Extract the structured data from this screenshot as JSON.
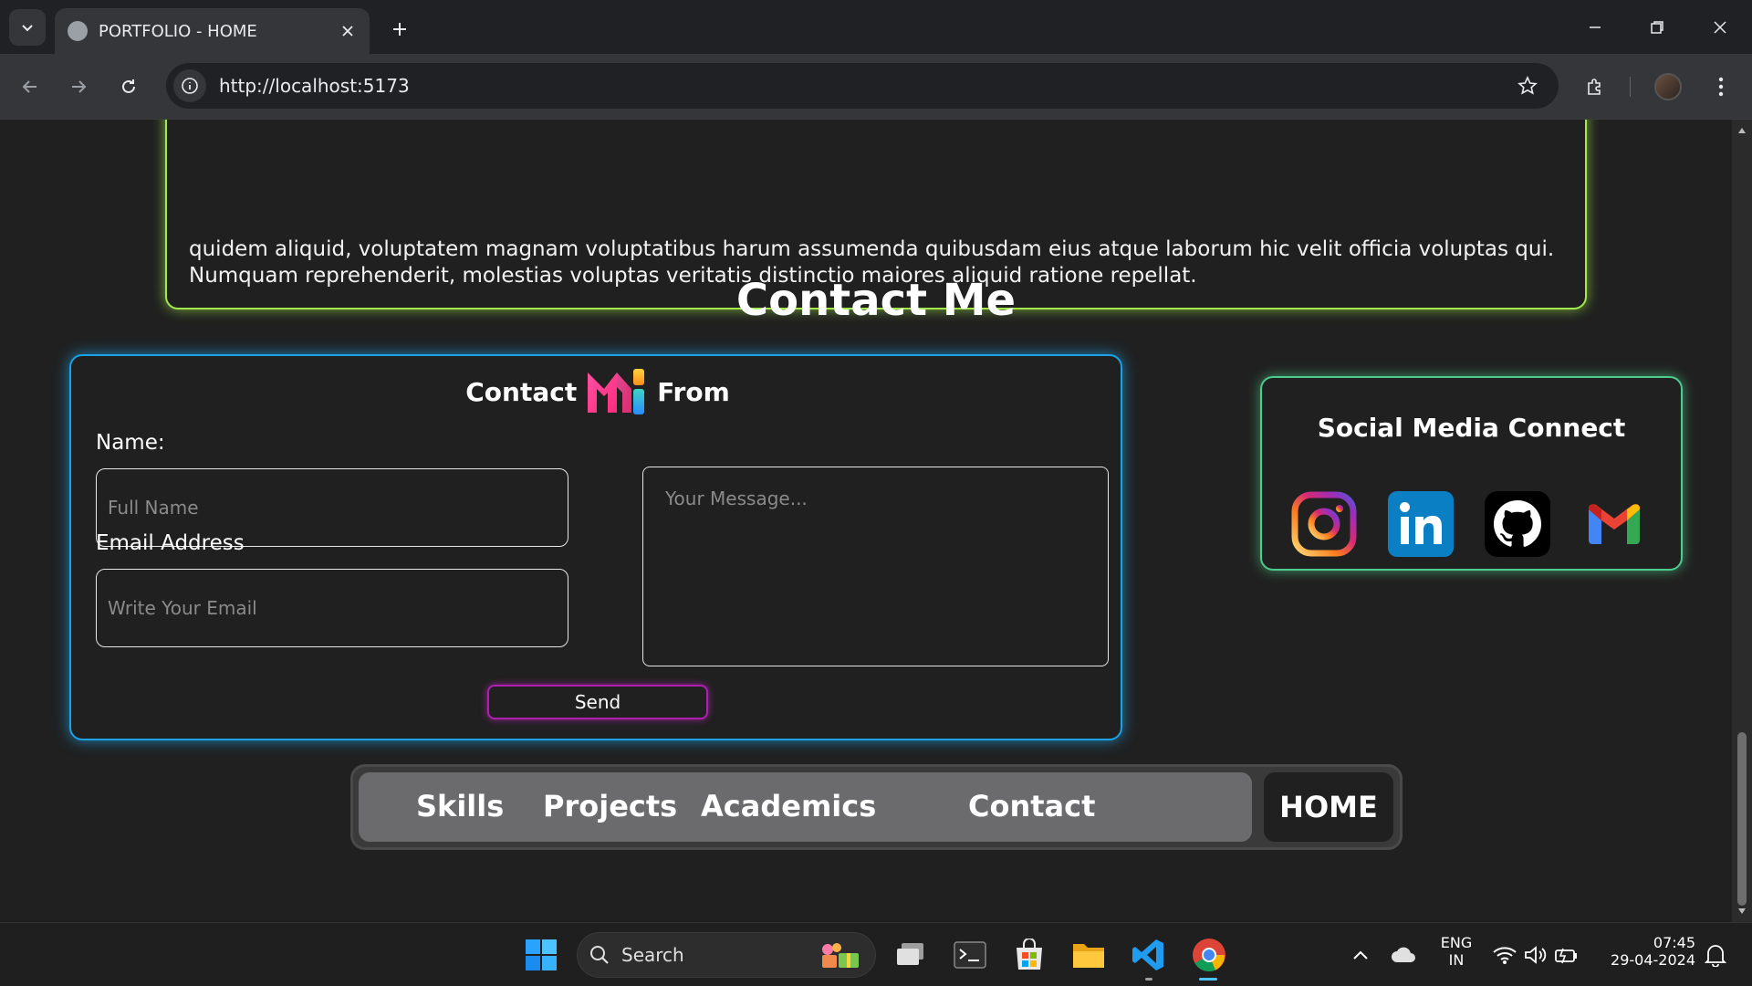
{
  "browser": {
    "tab_title": "PORTFOLIO - HOME",
    "url": "http://localhost:5173"
  },
  "page": {
    "about_text": "quidem aliquid, voluptatem magnam voluptatibus harum assumenda quibusdam eius atque laborum hic velit officia voluptas qui. Numquam reprehenderit, molestias voluptas veritatis distinctio maiores aliquid ratione repellat.",
    "contact_heading": "Contact Me",
    "form": {
      "title_left": "Contact",
      "title_right": "From",
      "name_label": "Name:",
      "name_placeholder": "Full Name",
      "email_label": "Email Address",
      "email_placeholder": "Write Your Email",
      "message_placeholder": "Your Message...",
      "send_label": "Send"
    },
    "social": {
      "title": "Social Media Connect",
      "icons": [
        "instagram-icon",
        "linkedin-icon",
        "github-icon",
        "gmail-icon"
      ]
    },
    "nav": {
      "items": [
        "Skills",
        "Projects",
        "Academics",
        "Contact"
      ],
      "home": "HOME"
    }
  },
  "taskbar": {
    "search_label": "Search",
    "lang_line1": "ENG",
    "lang_line2": "IN",
    "time": "07:45",
    "date": "29-04-2024"
  },
  "colors": {
    "about_border": "#a4e94a",
    "form_border": "#1aa3e6",
    "social_border": "#4ecb8f",
    "send_border": "#b01fb0"
  }
}
